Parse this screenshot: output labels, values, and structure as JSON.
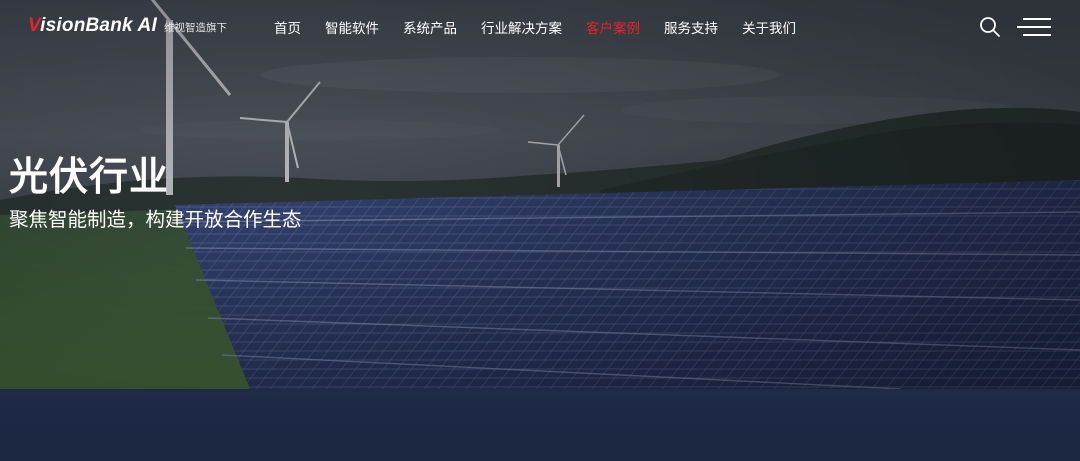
{
  "header": {
    "logo": {
      "brand": "VisionBank AI",
      "brand_initial": "V",
      "brand_rest": "isionBank AI",
      "tagline": "维视智造旗下"
    },
    "nav": [
      {
        "label": "首页",
        "active": false
      },
      {
        "label": "智能软件",
        "active": false
      },
      {
        "label": "系统产品",
        "active": false
      },
      {
        "label": "行业解决方案",
        "active": false
      },
      {
        "label": "客户案例",
        "active": true
      },
      {
        "label": "服务支持",
        "active": false
      },
      {
        "label": "关于我们",
        "active": false
      }
    ],
    "icons": {
      "search": "search-icon",
      "menu": "hamburger-menu-icon"
    }
  },
  "hero": {
    "title": "光伏行业",
    "subtitle": "聚焦智能制造，构建开放合作生态"
  },
  "colors": {
    "accent": "#e8232b",
    "text": "#ffffff",
    "bottom_band": "#1e2a46"
  }
}
